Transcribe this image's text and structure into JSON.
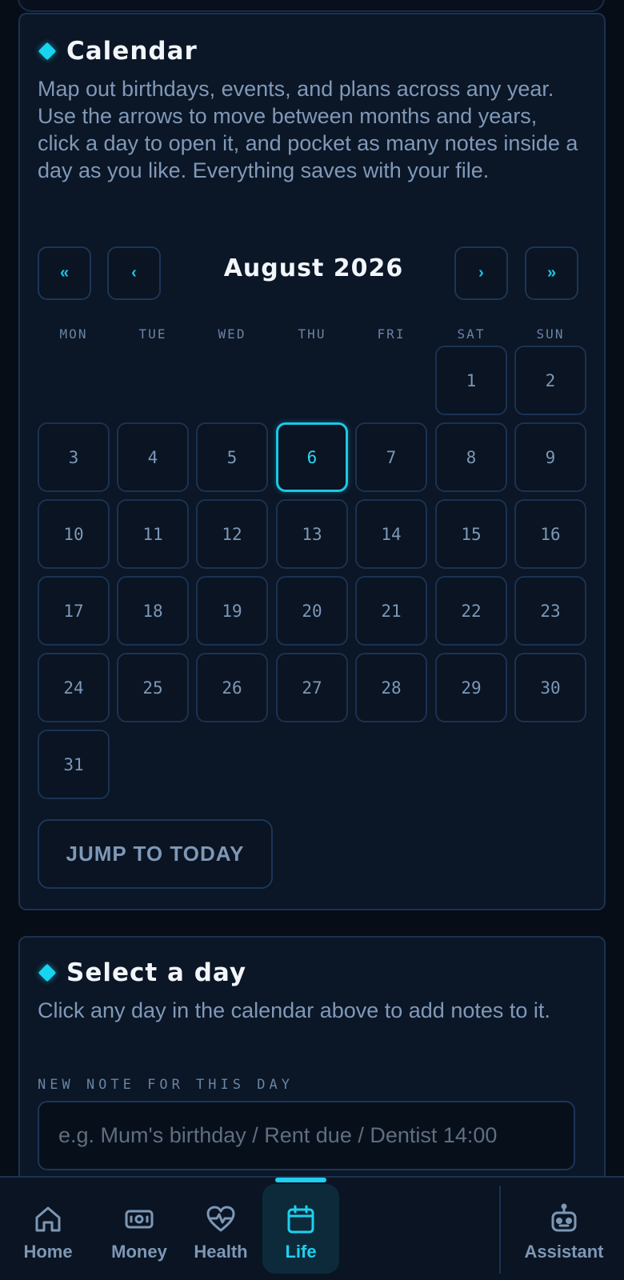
{
  "calendar": {
    "title": "Calendar",
    "description": "Map out birthdays, events, and plans across any year. Use the arrows to move between months and years, click a day to open it, and pocket as many notes inside a day as you like. Everything saves with your file.",
    "month_label": "August 2026",
    "nav": {
      "prev_year": "«",
      "prev_month": "‹",
      "next_month": "›",
      "next_year": "»"
    },
    "weekdays": [
      "MON",
      "TUE",
      "WED",
      "THU",
      "FRI",
      "SAT",
      "SUN"
    ],
    "days": [
      "1",
      "2",
      "3",
      "4",
      "5",
      "6",
      "7",
      "8",
      "9",
      "10",
      "11",
      "12",
      "13",
      "14",
      "15",
      "16",
      "17",
      "18",
      "19",
      "20",
      "21",
      "22",
      "23",
      "24",
      "25",
      "26",
      "27",
      "28",
      "29",
      "30",
      "31"
    ],
    "first_weekday_index": 5,
    "selected_day": "6",
    "jump_today_label": "JUMP TO TODAY"
  },
  "day_panel": {
    "title": "Select a day",
    "description": "Click any day in the calendar above to add notes to it.",
    "note_label": "NEW NOTE FOR THIS DAY",
    "note_placeholder": "e.g. Mum's birthday / Rent due / Dentist 14:00",
    "note_value": ""
  },
  "bottom_nav": {
    "items": [
      {
        "label": "Home",
        "icon": "home-icon"
      },
      {
        "label": "Money",
        "icon": "money-icon"
      },
      {
        "label": "Health",
        "icon": "heart-pulse-icon"
      },
      {
        "label": "Life",
        "icon": "calendar-icon"
      },
      {
        "label": "Assistant",
        "icon": "robot-icon"
      }
    ],
    "active": "Life"
  },
  "colors": {
    "background": "#060d17",
    "card": "#0b1626",
    "border": "#1b3252",
    "accent": "#19c9e6",
    "text": "#8ca3c0",
    "title": "#f2f6fb"
  }
}
